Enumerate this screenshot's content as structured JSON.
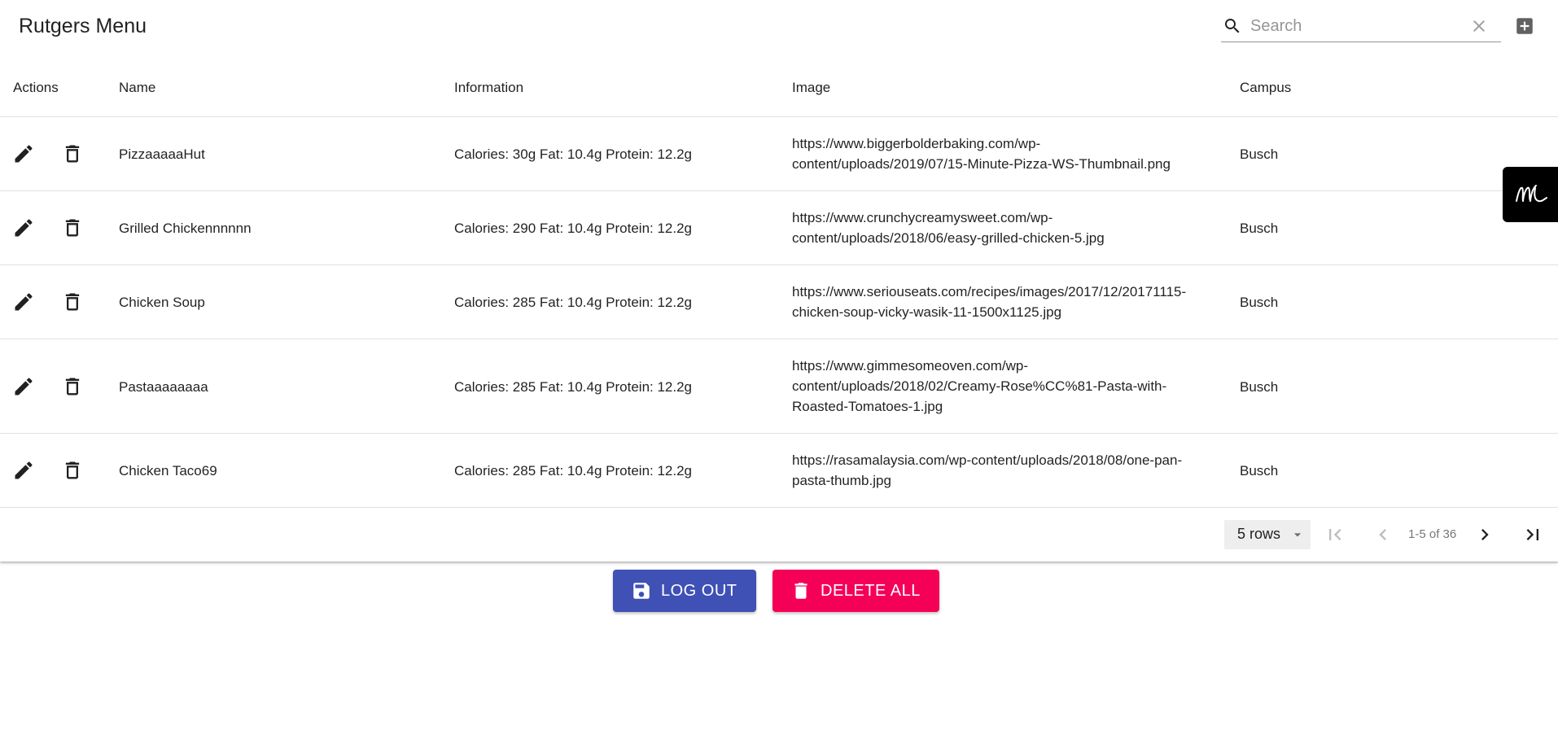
{
  "toolbar": {
    "title": "Rutgers Menu",
    "search_placeholder": "Search",
    "search_value": ""
  },
  "table": {
    "columns": [
      "Actions",
      "Name",
      "Information",
      "Image",
      "Campus"
    ],
    "rows": [
      {
        "name": "PizzaaaaaHut",
        "information": "Calories: 30g Fat: 10.4g Protein: 12.2g",
        "image_lines": [
          "https://www.biggerbolderbaking.com/wp-",
          "content/uploads/2019/07/15-Minute-Pizza-WS-Thumbnail.png"
        ],
        "campus": "Busch"
      },
      {
        "name": "Grilled Chickennnnnn",
        "information": "Calories: 290 Fat: 10.4g Protein: 12.2g",
        "image_lines": [
          "https://www.crunchycreamysweet.com/wp-",
          "content/uploads/2018/06/easy-grilled-chicken-5.jpg"
        ],
        "campus": "Busch"
      },
      {
        "name": "Chicken Soup",
        "information": "Calories: 285 Fat: 10.4g Protein: 12.2g",
        "image_lines": [
          "https://www.seriouseats.com/recipes/images/2017/12/20171115-",
          "chicken-soup-vicky-wasik-11-1500x1125.jpg"
        ],
        "campus": "Busch"
      },
      {
        "name": "Pastaaaaaaaa",
        "information": "Calories: 285 Fat: 10.4g Protein: 12.2g",
        "image_lines": [
          "https://www.gimmesomeoven.com/wp-",
          "content/uploads/2018/02/Creamy-Rose%CC%81-Pasta-with-",
          "Roasted-Tomatoes-1.jpg"
        ],
        "campus": "Busch"
      },
      {
        "name": "Chicken Taco69",
        "information": "Calories: 285 Fat: 10.4g Protein: 12.2g",
        "image_lines": [
          "https://rasamalaysia.com/wp-content/uploads/2018/08/one-pan-",
          "pasta-thumb.jpg"
        ],
        "campus": "Busch"
      }
    ]
  },
  "pagination": {
    "rows_per_page_label": "5 rows",
    "range_label": "1-5 of 36"
  },
  "actions": {
    "logout_label": "LOG OUT",
    "delete_all_label": "DELETE ALL"
  },
  "icons": {
    "edit": "pencil-icon",
    "delete": "trash-icon",
    "search": "search-icon",
    "clear": "close-icon",
    "add": "add-box-icon",
    "logout": "save-icon",
    "first_page": "first-page-icon",
    "prev_page": "chevron-left-icon",
    "next_page": "chevron-right-icon",
    "last_page": "last-page-icon",
    "floating_tab": "m-logo-icon"
  },
  "colors": {
    "logout_button": "#3f51b5",
    "delete_all_button": "#f50057",
    "floating_tab": "#000000"
  }
}
